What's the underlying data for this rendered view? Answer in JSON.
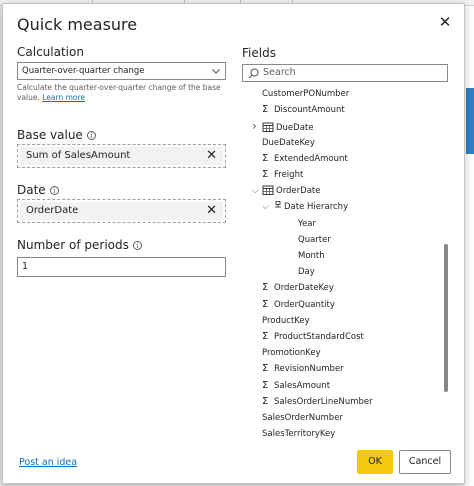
{
  "dialog": {
    "title": "Quick measure",
    "close_glyph": "✕"
  },
  "calculation": {
    "label": "Calculation",
    "selected": "Quarter-over-quarter change",
    "description": "Calculate the quarter-over-quarter change of the base value.",
    "learn_more": "Learn more"
  },
  "base_value": {
    "label": "Base value",
    "value": "Sum of SalesAmount"
  },
  "date": {
    "label": "Date",
    "value": "OrderDate"
  },
  "periods": {
    "label": "Number of periods",
    "value": "1"
  },
  "fields": {
    "label": "Fields",
    "search_placeholder": "Search",
    "items": [
      {
        "label": "CustomerPONumber",
        "icon": "none",
        "indent": 1
      },
      {
        "label": "DiscountAmount",
        "icon": "sigma",
        "indent": 1
      },
      {
        "label": "DueDate",
        "icon": "calendar",
        "indent": 1,
        "expander": "collapsed"
      },
      {
        "label": "DueDateKey",
        "icon": "none",
        "indent": 1
      },
      {
        "label": "ExtendedAmount",
        "icon": "sigma",
        "indent": 1
      },
      {
        "label": "Freight",
        "icon": "sigma",
        "indent": 1
      },
      {
        "label": "OrderDate",
        "icon": "calendar",
        "indent": 1,
        "expander": "expanded"
      },
      {
        "label": "Date Hierarchy",
        "icon": "hierarchy",
        "indent": 2,
        "expander": "expanded"
      },
      {
        "label": "Year",
        "icon": "none",
        "indent": 3
      },
      {
        "label": "Quarter",
        "icon": "none",
        "indent": 3
      },
      {
        "label": "Month",
        "icon": "none",
        "indent": 3
      },
      {
        "label": "Day",
        "icon": "none",
        "indent": 3
      },
      {
        "label": "OrderDateKey",
        "icon": "sigma",
        "indent": 1
      },
      {
        "label": "OrderQuantity",
        "icon": "sigma",
        "indent": 1
      },
      {
        "label": "ProductKey",
        "icon": "none",
        "indent": 1
      },
      {
        "label": "ProductStandardCost",
        "icon": "sigma",
        "indent": 1
      },
      {
        "label": "PromotionKey",
        "icon": "none",
        "indent": 1
      },
      {
        "label": "RevisionNumber",
        "icon": "sigma",
        "indent": 1
      },
      {
        "label": "SalesAmount",
        "icon": "sigma",
        "indent": 1
      },
      {
        "label": "SalesOrderLineNumber",
        "icon": "sigma",
        "indent": 1
      },
      {
        "label": "SalesOrderNumber",
        "icon": "none",
        "indent": 1
      },
      {
        "label": "SalesTerritoryKey",
        "icon": "none",
        "indent": 1
      }
    ]
  },
  "footer": {
    "post_idea": "Post an idea",
    "ok_label": "OK",
    "cancel_label": "Cancel"
  },
  "colors": {
    "primary_button": "#f2c811",
    "link": "#106ebe"
  }
}
